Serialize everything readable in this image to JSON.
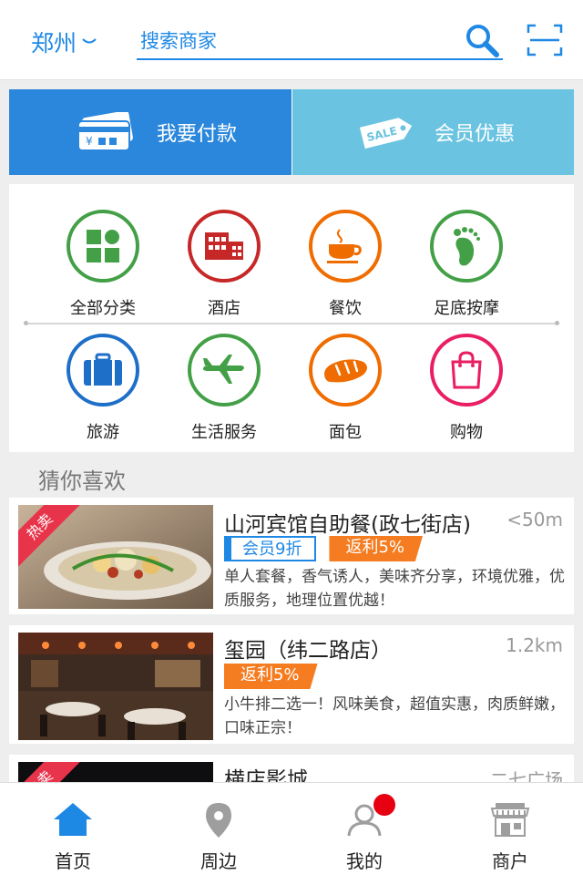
{
  "header": {
    "city": "郑州",
    "search_placeholder": "搜索商家"
  },
  "banners": {
    "pay_label": "我要付款",
    "vip_label": "会员优惠"
  },
  "categories": [
    {
      "label": "全部分类",
      "color": "#43a047",
      "icon": "grid-icon"
    },
    {
      "label": "酒店",
      "color": "#c62828",
      "icon": "hotel-icon"
    },
    {
      "label": "餐饮",
      "color": "#ef6c00",
      "icon": "coffee-cup-icon"
    },
    {
      "label": "足底按摩",
      "color": "#43a047",
      "icon": "footprint-icon"
    },
    {
      "label": "旅游",
      "color": "#1e6fc8",
      "icon": "suitcase-icon"
    },
    {
      "label": "生活服务",
      "color": "#43a047",
      "icon": "airplane-icon"
    },
    {
      "label": "面包",
      "color": "#ef6c00",
      "icon": "bread-icon"
    },
    {
      "label": "购物",
      "color": "#e91e63",
      "icon": "shopping-bag-icon"
    }
  ],
  "section_title": "猜你喜欢",
  "listings": [
    {
      "name": "山河宾馆自助餐(政七街店)",
      "distance": "<50m",
      "hot": "热卖",
      "tags": [
        "会员9折",
        "返利5%"
      ],
      "desc": "单人套餐，香气诱人，美味齐分享，环境优雅，优质服务，地理位置优越！"
    },
    {
      "name": "玺园（纬二路店）",
      "distance": "1.2km",
      "tags": [
        "返利5%"
      ],
      "desc": "小牛排二选一！风味美食，超值实惠，肉质鲜嫩，口味正宗！"
    },
    {
      "name": "横店影城",
      "distance": "二七广场",
      "hot": "热卖"
    }
  ],
  "bottom_nav": [
    {
      "label": "首页",
      "icon": "home-icon",
      "active": true
    },
    {
      "label": "周边",
      "icon": "location-pin-icon"
    },
    {
      "label": "我的",
      "icon": "user-icon"
    },
    {
      "label": "商户",
      "icon": "storefront-icon"
    }
  ],
  "colors": {
    "accent": "#1e88e5",
    "pay_banner": "#2b87dc",
    "vip_banner": "#6ac3e0",
    "rebate": "#f57c20",
    "hot": "#e8344b",
    "badge": "#e60012"
  }
}
